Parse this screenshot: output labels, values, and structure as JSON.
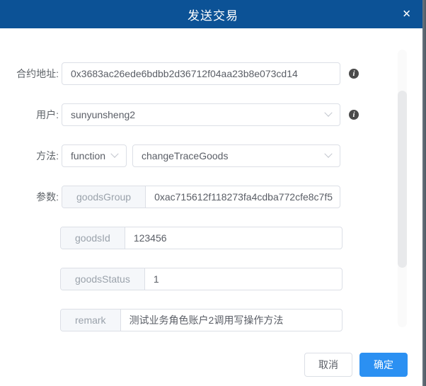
{
  "dialog": {
    "title": "发送交易"
  },
  "icons": {
    "close": "✕",
    "info": "i"
  },
  "form": {
    "contract_address": {
      "label": "合约地址:",
      "value": "0x3683ac26ede6bdbb2d36712f04aa23b8e073cd14"
    },
    "user": {
      "label": "用户:",
      "value": "sunyunsheng2"
    },
    "method": {
      "label": "方法:",
      "type_value": "function",
      "name_value": "changeTraceGoods"
    },
    "params": {
      "label": "参数:",
      "fields": [
        {
          "name": "goodsGroup",
          "value": "0xac715612f118273fa4cdba772cfe8c7f5"
        },
        {
          "name": "goodsId",
          "value": "123456"
        },
        {
          "name": "goodsStatus",
          "value": "1"
        },
        {
          "name": "remark",
          "value": "测试业务角色账户2调用写操作方法"
        }
      ]
    }
  },
  "footer": {
    "cancel_label": "取消",
    "confirm_label": "确定"
  },
  "colors": {
    "header_bg": "#0c5296",
    "primary_button": "#2b90f2",
    "input_border": "#dcdfe6",
    "prepend_bg": "#f5f7fa"
  }
}
